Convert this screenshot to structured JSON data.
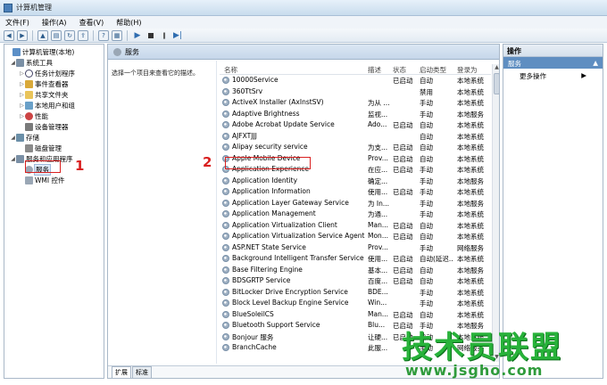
{
  "window": {
    "title": "计算机管理"
  },
  "menu": {
    "items": [
      "文件(F)",
      "操作(A)",
      "查看(V)",
      "帮助(H)"
    ]
  },
  "tree": {
    "items": [
      {
        "label": "计算机管理(本地)",
        "expander": ""
      },
      {
        "label": "系统工具",
        "expander": "◢"
      },
      {
        "label": "任务计划程序",
        "expander": "▷"
      },
      {
        "label": "事件查看器",
        "expander": "▷"
      },
      {
        "label": "共享文件夹",
        "expander": "▷"
      },
      {
        "label": "本地用户和组",
        "expander": "▷"
      },
      {
        "label": "性能",
        "expander": "▷"
      },
      {
        "label": "设备管理器",
        "expander": ""
      },
      {
        "label": "存储",
        "expander": "◢"
      },
      {
        "label": "磁盘管理",
        "expander": ""
      },
      {
        "label": "服务和应用程序",
        "expander": "◢"
      },
      {
        "label": "服务",
        "expander": ""
      },
      {
        "label": "WMI 控件",
        "expander": ""
      }
    ]
  },
  "annotations": {
    "one": "1",
    "two": "2"
  },
  "center": {
    "title": "服务",
    "description": "选择一个项目来查看它的描述。",
    "columns": {
      "name": "名称",
      "desc": "描述",
      "status": "状态",
      "start": "启动类型",
      "logon": "登录为"
    },
    "rows": [
      {
        "name": "10000Service",
        "desc": "",
        "status": "已启动",
        "start": "自动",
        "logon": "本地系统"
      },
      {
        "name": "360TtSrv",
        "desc": "",
        "status": "",
        "start": "禁用",
        "logon": "本地系统"
      },
      {
        "name": "ActiveX Installer (AxInstSV)",
        "desc": "为从 ...",
        "status": "",
        "start": "手动",
        "logon": "本地系统"
      },
      {
        "name": "Adaptive Brightness",
        "desc": "监视...",
        "status": "",
        "start": "手动",
        "logon": "本地服务"
      },
      {
        "name": "Adobe Acrobat Update Service",
        "desc": "Ado...",
        "status": "已启动",
        "start": "自动",
        "logon": "本地系统"
      },
      {
        "name": "AJFXTJJJ",
        "desc": "",
        "status": "",
        "start": "自动",
        "logon": "本地系统"
      },
      {
        "name": "Alipay security service",
        "desc": "为支...",
        "status": "已启动",
        "start": "自动",
        "logon": "本地系统"
      },
      {
        "name": "Apple Mobile Device",
        "desc": "Prov...",
        "status": "已启动",
        "start": "自动",
        "logon": "本地系统"
      },
      {
        "name": "Application Experience",
        "desc": "在应...",
        "status": "已启动",
        "start": "手动",
        "logon": "本地系统"
      },
      {
        "name": "Application Identity",
        "desc": "确定...",
        "status": "",
        "start": "手动",
        "logon": "本地服务"
      },
      {
        "name": "Application Information",
        "desc": "使用...",
        "status": "已启动",
        "start": "手动",
        "logon": "本地系统"
      },
      {
        "name": "Application Layer Gateway Service",
        "desc": "为 In...",
        "status": "",
        "start": "手动",
        "logon": "本地服务"
      },
      {
        "name": "Application Management",
        "desc": "为通...",
        "status": "",
        "start": "手动",
        "logon": "本地系统"
      },
      {
        "name": "Application Virtualization Client",
        "desc": "Man...",
        "status": "已启动",
        "start": "自动",
        "logon": "本地系统"
      },
      {
        "name": "Application Virtualization Service Agent",
        "desc": "Mon...",
        "status": "已启动",
        "start": "自动",
        "logon": "本地系统"
      },
      {
        "name": "ASP.NET State Service",
        "desc": "Prov...",
        "status": "",
        "start": "手动",
        "logon": "网络服务"
      },
      {
        "name": "Background Intelligent Transfer Service",
        "desc": "使用...",
        "status": "已启动",
        "start": "自动(延迟...",
        "logon": "本地系统"
      },
      {
        "name": "Base Filtering Engine",
        "desc": "基本...",
        "status": "已启动",
        "start": "自动",
        "logon": "本地服务"
      },
      {
        "name": "BDSGRTP Service",
        "desc": "百度...",
        "status": "已启动",
        "start": "自动",
        "logon": "本地系统"
      },
      {
        "name": "BitLocker Drive Encryption Service",
        "desc": "BDE...",
        "status": "",
        "start": "手动",
        "logon": "本地系统"
      },
      {
        "name": "Block Level Backup Engine Service",
        "desc": "Win...",
        "status": "",
        "start": "手动",
        "logon": "本地系统"
      },
      {
        "name": "BlueSoleilCS",
        "desc": "Man...",
        "status": "已启动",
        "start": "自动",
        "logon": "本地系统"
      },
      {
        "name": "Bluetooth Support Service",
        "desc": "Blu...",
        "status": "已启动",
        "start": "手动",
        "logon": "本地服务"
      },
      {
        "name": "Bonjour 服务",
        "desc": "让硬...",
        "status": "已启动",
        "start": "自动",
        "logon": "本地系统"
      },
      {
        "name": "BranchCache",
        "desc": "此服...",
        "status": "",
        "start": "手动",
        "logon": "网络服务"
      }
    ],
    "tabs": [
      "扩展",
      "标准"
    ]
  },
  "actions": {
    "header": "操作",
    "section": "服务",
    "item": "更多操作"
  },
  "watermark": {
    "text": "技术员联盟",
    "url": "www.jsgho.com"
  }
}
